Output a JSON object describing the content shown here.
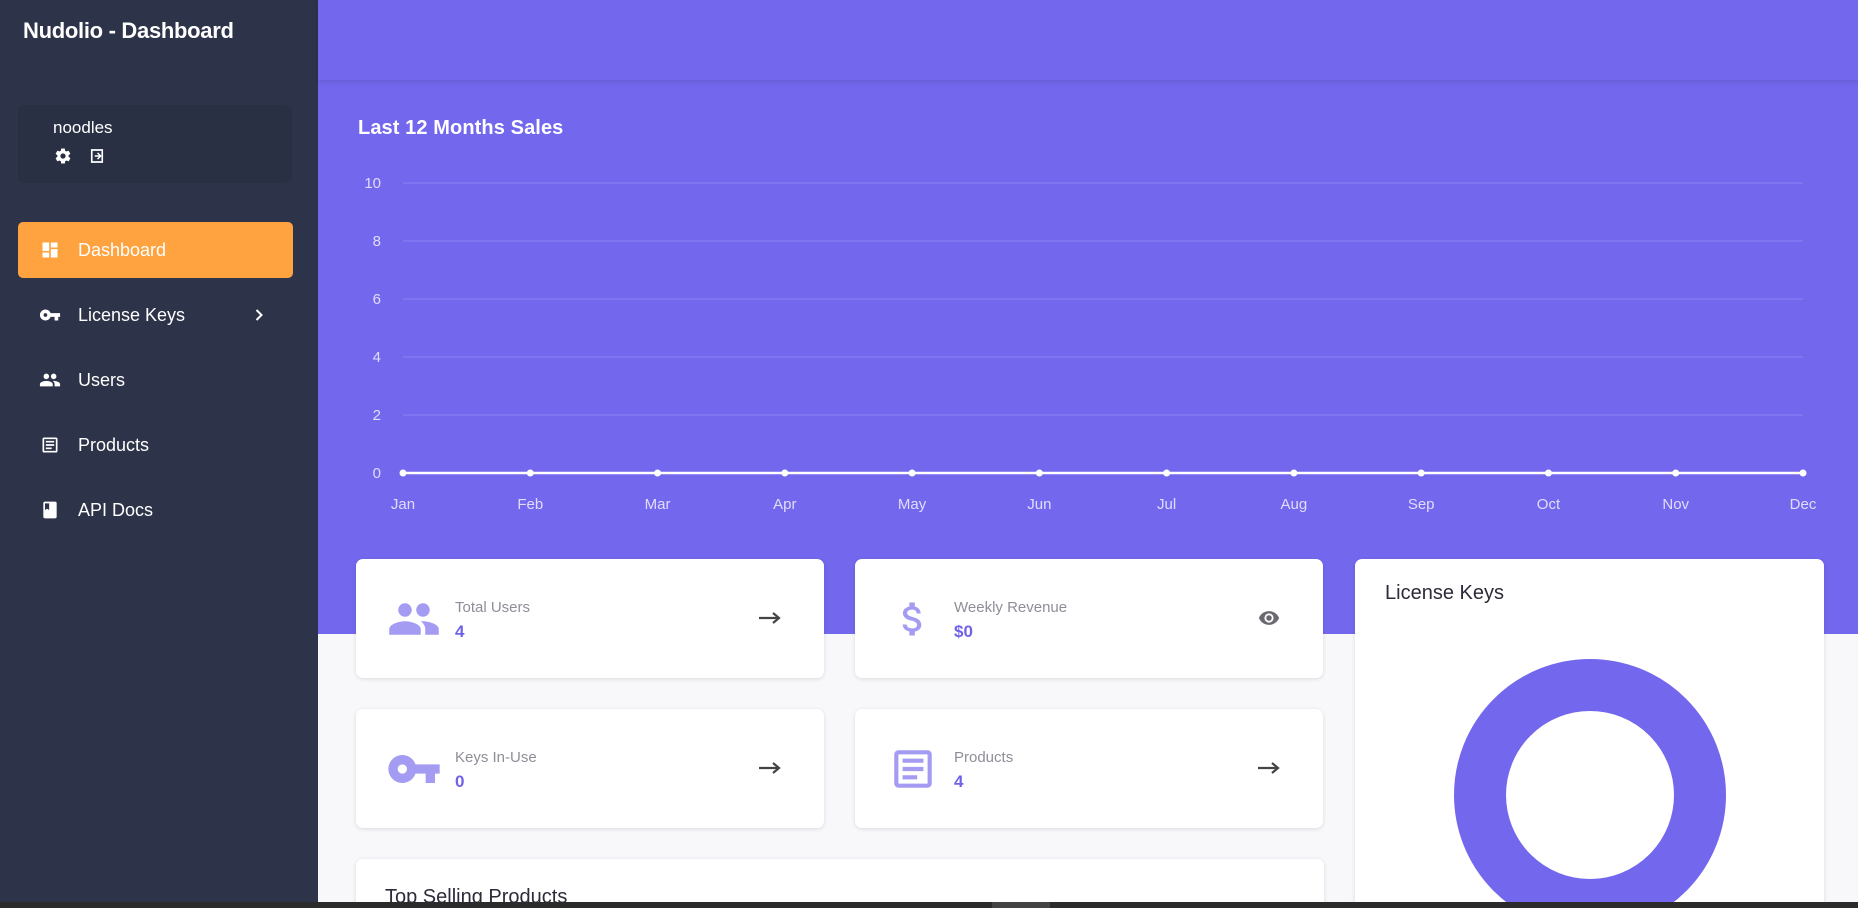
{
  "app": {
    "title": "Nudolio - Dashboard"
  },
  "user": {
    "name": "noodles",
    "icons": [
      "gear-icon",
      "logout-icon"
    ]
  },
  "nav": {
    "items": [
      {
        "label": "Dashboard",
        "icon": "dashboard-icon",
        "active": true
      },
      {
        "label": "License Keys",
        "icon": "key-icon",
        "has_submenu": true
      },
      {
        "label": "Users",
        "icon": "users-icon"
      },
      {
        "label": "Products",
        "icon": "products-icon"
      },
      {
        "label": "API Docs",
        "icon": "book-icon"
      }
    ]
  },
  "colors": {
    "accent": "#7367ee",
    "active_nav": "#fea33f",
    "sidebar": "#2d3349",
    "stat_value": "#6f62e9",
    "icon_light": "#a39cf2"
  },
  "chart_data": {
    "type": "line",
    "title": "Last 12 Months Sales",
    "x": [
      "Jan",
      "Feb",
      "Mar",
      "Apr",
      "May",
      "Jun",
      "Jul",
      "Aug",
      "Sep",
      "Oct",
      "Nov",
      "Dec"
    ],
    "series": [
      {
        "values": [
          0,
          0,
          0,
          0,
          0,
          0,
          0,
          0,
          0,
          0,
          0,
          0
        ]
      }
    ],
    "ylim": [
      0,
      10
    ],
    "yticks": [
      0,
      2,
      4,
      6,
      8,
      10
    ],
    "grid": true
  },
  "stats": [
    {
      "label": "Total Users",
      "value": "4",
      "icon": "users-icon",
      "action": "arrow-right-icon"
    },
    {
      "label": "Weekly Revenue",
      "value": "$0",
      "icon": "dollar-icon",
      "action": "eye-icon"
    },
    {
      "label": "Keys In-Use",
      "value": "0",
      "icon": "key-icon",
      "action": "arrow-right-icon"
    },
    {
      "label": "Products",
      "value": "4",
      "icon": "products-icon",
      "action": "arrow-right-icon"
    }
  ],
  "license_keys": {
    "title": "License Keys"
  },
  "top_selling": {
    "title": "Top Selling Products"
  }
}
